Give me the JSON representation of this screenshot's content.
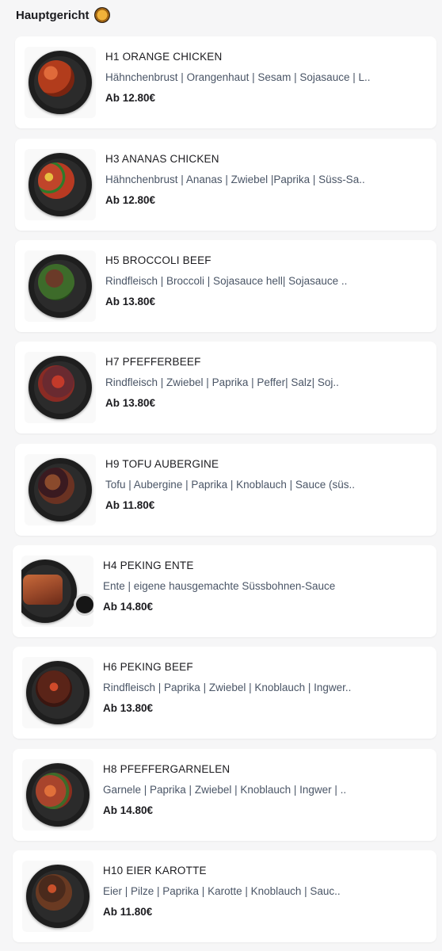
{
  "section": {
    "title": "Hauptgericht",
    "emoji_icon": "curry-bowl-icon"
  },
  "dishes": [
    {
      "name": "H1 ORANGE CHICKEN",
      "description": "Hähnchenbrust | Orangenhaut | Sesam | Sojasauce | L..",
      "price": "Ab 12.80€",
      "food_color": "#b23c1c"
    },
    {
      "name": "H3 ANANAS CHICKEN",
      "description": "Hähnchenbrust | Ananas | Zwiebel |Paprika | Süss-Sa..",
      "price": "Ab 12.80€",
      "food_color": "#c0452a"
    },
    {
      "name": "H5 BROCCOLI BEEF",
      "description": "Rindfleisch | Broccoli | Sojasauce hell| Sojasauce ..",
      "price": "Ab 13.80€",
      "food_color": "#3d6b2a"
    },
    {
      "name": "H7 PFEFFERBEEF",
      "description": "Rindfleisch | Zwiebel | Paprika | Peffer| Salz| Soj..",
      "price": "Ab 13.80€",
      "food_color": "#8a2b24"
    },
    {
      "name": "H9 TOFU AUBERGINE",
      "description": "Tofu | Aubergine | Paprika | Knoblauch | Sauce (süs..",
      "price": "Ab 11.80€",
      "food_color": "#6a3222"
    },
    {
      "name": "H4 PEKING ENTE",
      "description": "Ente | eigene hausgemachte Süssbohnen-Sauce",
      "price": "Ab 14.80€",
      "food_color": "#9c4a2a"
    },
    {
      "name": "H6 PEKING BEEF",
      "description": "Rindfleisch | Paprika | Zwiebel | Knoblauch | Ingwer..",
      "price": "Ab 13.80€",
      "food_color": "#5a2418"
    },
    {
      "name": "H8 PFEFFERGARNELEN",
      "description": "Garnele | Paprika | Zwiebel | Knoblauch | Ingwer | ..",
      "price": "Ab 14.80€",
      "food_color": "#a8442c"
    },
    {
      "name": "H10 EIER KAROTTE",
      "description": "Eier | Pilze | Paprika | Karotte | Knoblauch | Sauc..",
      "price": "Ab 11.80€",
      "food_color": "#4a2a1c"
    }
  ]
}
